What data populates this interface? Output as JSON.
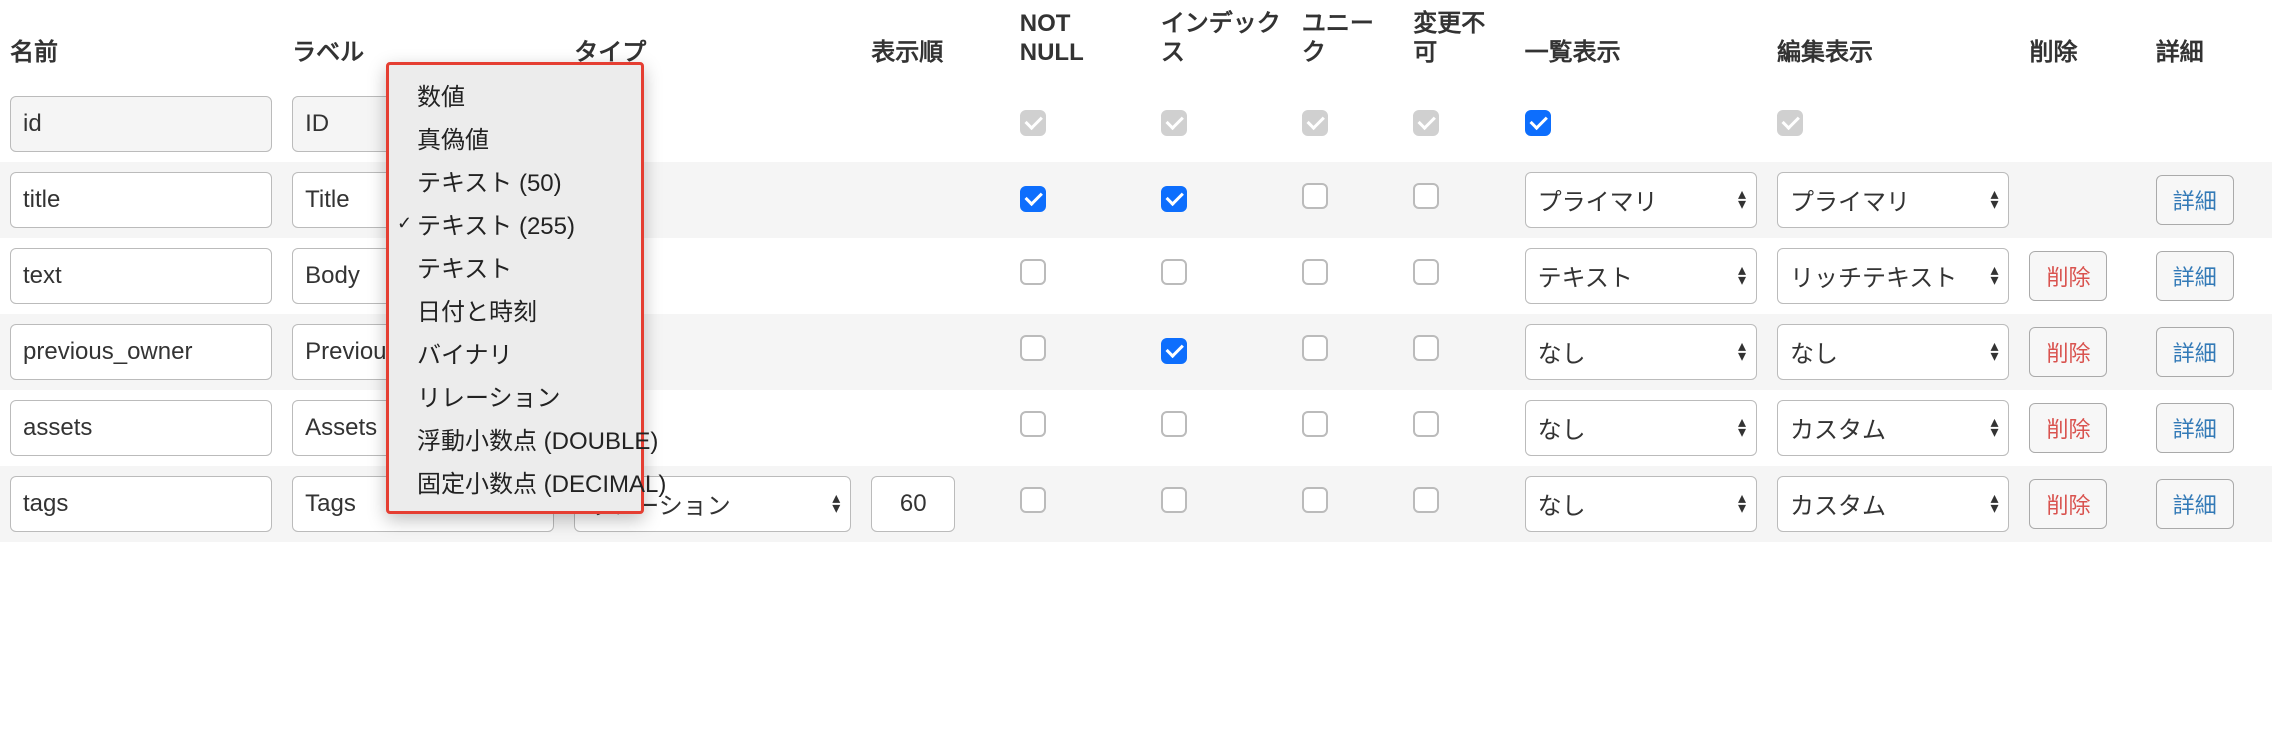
{
  "headers": {
    "name": "名前",
    "label": "ラベル",
    "type": "タイプ",
    "order": "表示順",
    "not_null": "NOT NULL",
    "index": "インデックス",
    "unique": "ユニーク",
    "readonly": "変更不可",
    "list_display": "一覧表示",
    "edit_display": "編集表示",
    "delete": "削除",
    "detail": "詳細"
  },
  "type_options": [
    {
      "label": "数値",
      "selected": false
    },
    {
      "label": "真偽値",
      "selected": false
    },
    {
      "label": "テキスト (50)",
      "selected": false
    },
    {
      "label": "テキスト (255)",
      "selected": true
    },
    {
      "label": "テキスト",
      "selected": false
    },
    {
      "label": "日付と時刻",
      "selected": false
    },
    {
      "label": "バイナリ",
      "selected": false
    },
    {
      "label": "リレーション",
      "selected": false
    },
    {
      "label": "浮動小数点 (DOUBLE)",
      "selected": false
    },
    {
      "label": "固定小数点 (DECIMAL)",
      "selected": false
    }
  ],
  "buttons": {
    "delete": "削除",
    "detail": "詳細"
  },
  "rows": [
    {
      "name": "id",
      "label": "ID",
      "type": "",
      "order": "",
      "not_null": "gray",
      "index": "gray",
      "unique": "gray",
      "readonly": "gray",
      "list_display_chk": "blue",
      "list_display_sel": null,
      "edit_display_chk": "gray",
      "edit_display_sel": null,
      "delete": false,
      "detail": false,
      "disabled": true
    },
    {
      "name": "title",
      "label": "Title",
      "type": "",
      "order": "",
      "not_null": "blue",
      "index": "blue",
      "unique": "off",
      "readonly": "off",
      "list_display_chk": null,
      "list_display_sel": "プライマリ",
      "edit_display_chk": null,
      "edit_display_sel": "プライマリ",
      "delete": false,
      "detail": true,
      "disabled": false
    },
    {
      "name": "text",
      "label": "Body",
      "type": "",
      "order": "",
      "not_null": "off",
      "index": "off",
      "unique": "off",
      "readonly": "off",
      "list_display_chk": null,
      "list_display_sel": "テキスト",
      "edit_display_chk": null,
      "edit_display_sel": "リッチテキスト",
      "delete": true,
      "detail": true,
      "disabled": false
    },
    {
      "name": "previous_owner",
      "label": "Previous Owner",
      "type": "",
      "order": "",
      "not_null": "off",
      "index": "blue",
      "unique": "off",
      "readonly": "off",
      "list_display_chk": null,
      "list_display_sel": "なし",
      "edit_display_chk": null,
      "edit_display_sel": "なし",
      "delete": true,
      "detail": true,
      "disabled": false
    },
    {
      "name": "assets",
      "label": "Assets",
      "type": "",
      "order": "",
      "not_null": "off",
      "index": "off",
      "unique": "off",
      "readonly": "off",
      "list_display_chk": null,
      "list_display_sel": "なし",
      "edit_display_chk": null,
      "edit_display_sel": "カスタム",
      "delete": true,
      "detail": true,
      "disabled": false
    },
    {
      "name": "tags",
      "label": "Tags",
      "type": "リレーション",
      "order": "60",
      "not_null": "off",
      "index": "off",
      "unique": "off",
      "readonly": "off",
      "list_display_chk": null,
      "list_display_sel": "なし",
      "edit_display_chk": null,
      "edit_display_sel": "カスタム",
      "delete": true,
      "detail": true,
      "disabled": false
    }
  ]
}
